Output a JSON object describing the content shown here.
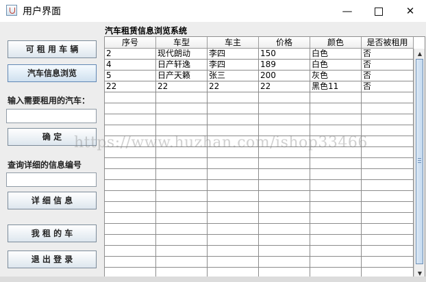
{
  "window": {
    "title": "用户界面",
    "minimize_glyph": "—",
    "close_glyph": "✕"
  },
  "sidebar": {
    "rent_button": "可 租 用 车 辆",
    "browse_button": "汽车信息浏览",
    "rent_input_label": "输入需要租用的汽车：",
    "rent_input_value": "",
    "confirm_button": "确        定",
    "query_label": "查询详细的信息编号",
    "query_input_value": "",
    "detail_button": "详 细 信 息",
    "my_cars_button": "我 租 的 车",
    "logout_button": "退 出 登 录"
  },
  "panel": {
    "title": "汽车租赁信息浏览系统"
  },
  "table": {
    "columns": [
      "序号",
      "车型",
      "车主",
      "价格",
      "颜色",
      "是否被租用"
    ],
    "rows": [
      [
        "2",
        "现代朗动",
        "李四",
        "150",
        "白色",
        "否"
      ],
      [
        "4",
        "日产轩逸",
        "李四",
        "189",
        "白色",
        "否"
      ],
      [
        "5",
        "日产天籁",
        "张三",
        "200",
        "灰色",
        "否"
      ],
      [
        "22",
        "22",
        "22",
        "22",
        "黑色11",
        "否"
      ],
      [
        "",
        "",
        "",
        "",
        "",
        ""
      ],
      [
        "",
        "",
        "",
        "",
        "",
        ""
      ],
      [
        "",
        "",
        "",
        "",
        "",
        ""
      ],
      [
        "",
        "",
        "",
        "",
        "",
        ""
      ],
      [
        "",
        "",
        "",
        "",
        "",
        ""
      ],
      [
        "",
        "",
        "",
        "",
        "",
        ""
      ],
      [
        "",
        "",
        "",
        "",
        "",
        ""
      ],
      [
        "",
        "",
        "",
        "",
        "",
        ""
      ],
      [
        "",
        "",
        "",
        "",
        "",
        ""
      ],
      [
        "",
        "",
        "",
        "",
        "",
        ""
      ],
      [
        "",
        "",
        "",
        "",
        "",
        ""
      ],
      [
        "",
        "",
        "",
        "",
        "",
        ""
      ],
      [
        "",
        "",
        "",
        "",
        "",
        ""
      ],
      [
        "",
        "",
        "",
        "",
        "",
        ""
      ],
      [
        "",
        "",
        "",
        "",
        "",
        ""
      ],
      [
        "",
        "",
        "",
        "",
        "",
        ""
      ],
      [
        "",
        "",
        "",
        "",
        "",
        ""
      ]
    ]
  },
  "watermark": "https://www.huzhan.com/ishop33466"
}
